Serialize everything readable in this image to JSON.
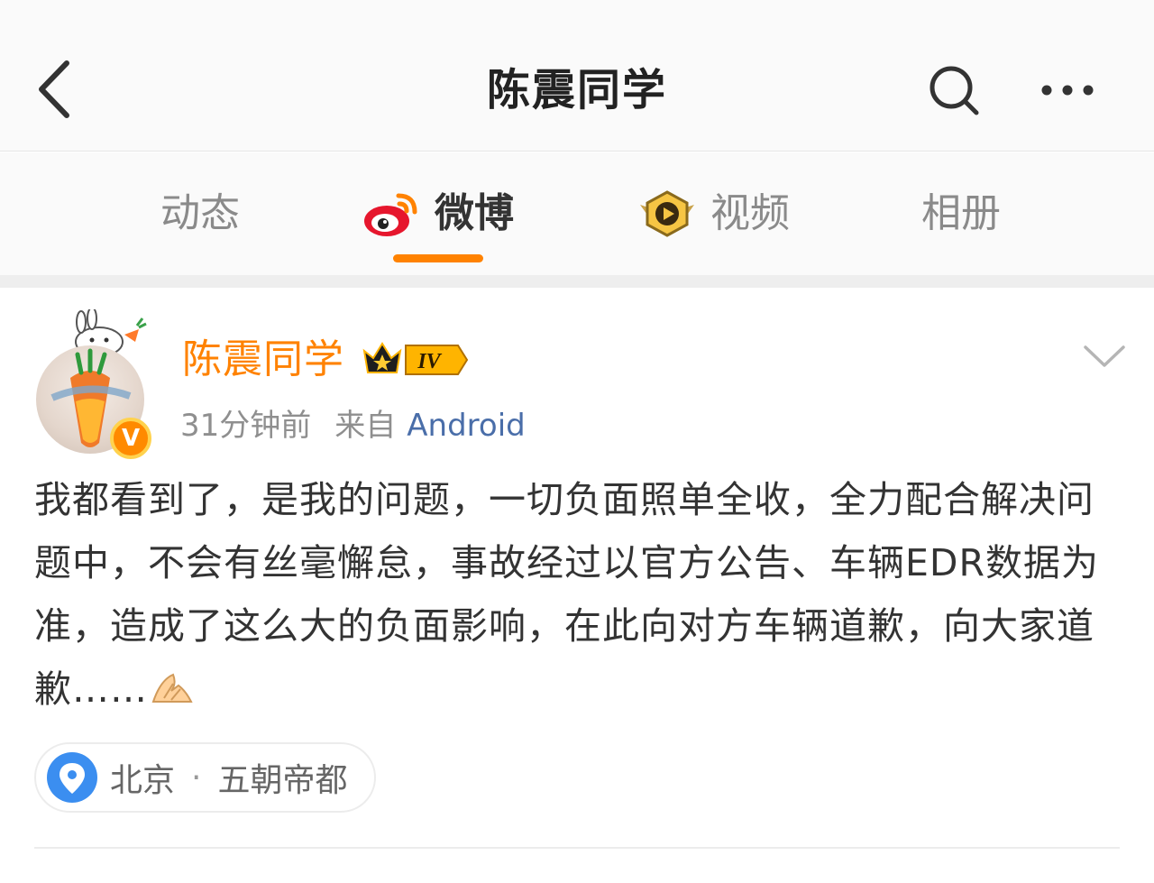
{
  "header": {
    "title": "陈震同学"
  },
  "tabs": [
    {
      "label": "动态",
      "active": false
    },
    {
      "label": "微博",
      "active": true,
      "icon": "weibo-logo-icon"
    },
    {
      "label": "视频",
      "active": false,
      "icon": "video-play-badge-icon"
    },
    {
      "label": "相册",
      "active": false
    }
  ],
  "post": {
    "author": "陈震同学",
    "vip_level": "IV",
    "verified_mark": "V",
    "time": "31分钟前",
    "source_label": "来自",
    "source_app": "Android",
    "text": "我都看到了，是我的问题，一切负面照单全收，全力配合解决问题中，不会有丝毫懈怠，事故经过以官方公告、车辆EDR数据为准，造成了这么大的负面影响，在此向对方车辆道歉，向大家道歉……",
    "emoji": "folded-hands-emoji",
    "location": {
      "city": "北京",
      "separator": "·",
      "area": "五朝帝都"
    }
  },
  "colors": {
    "accent": "#ff8200",
    "link": "#4a6ea9",
    "location_pin": "#3b8ef0"
  }
}
